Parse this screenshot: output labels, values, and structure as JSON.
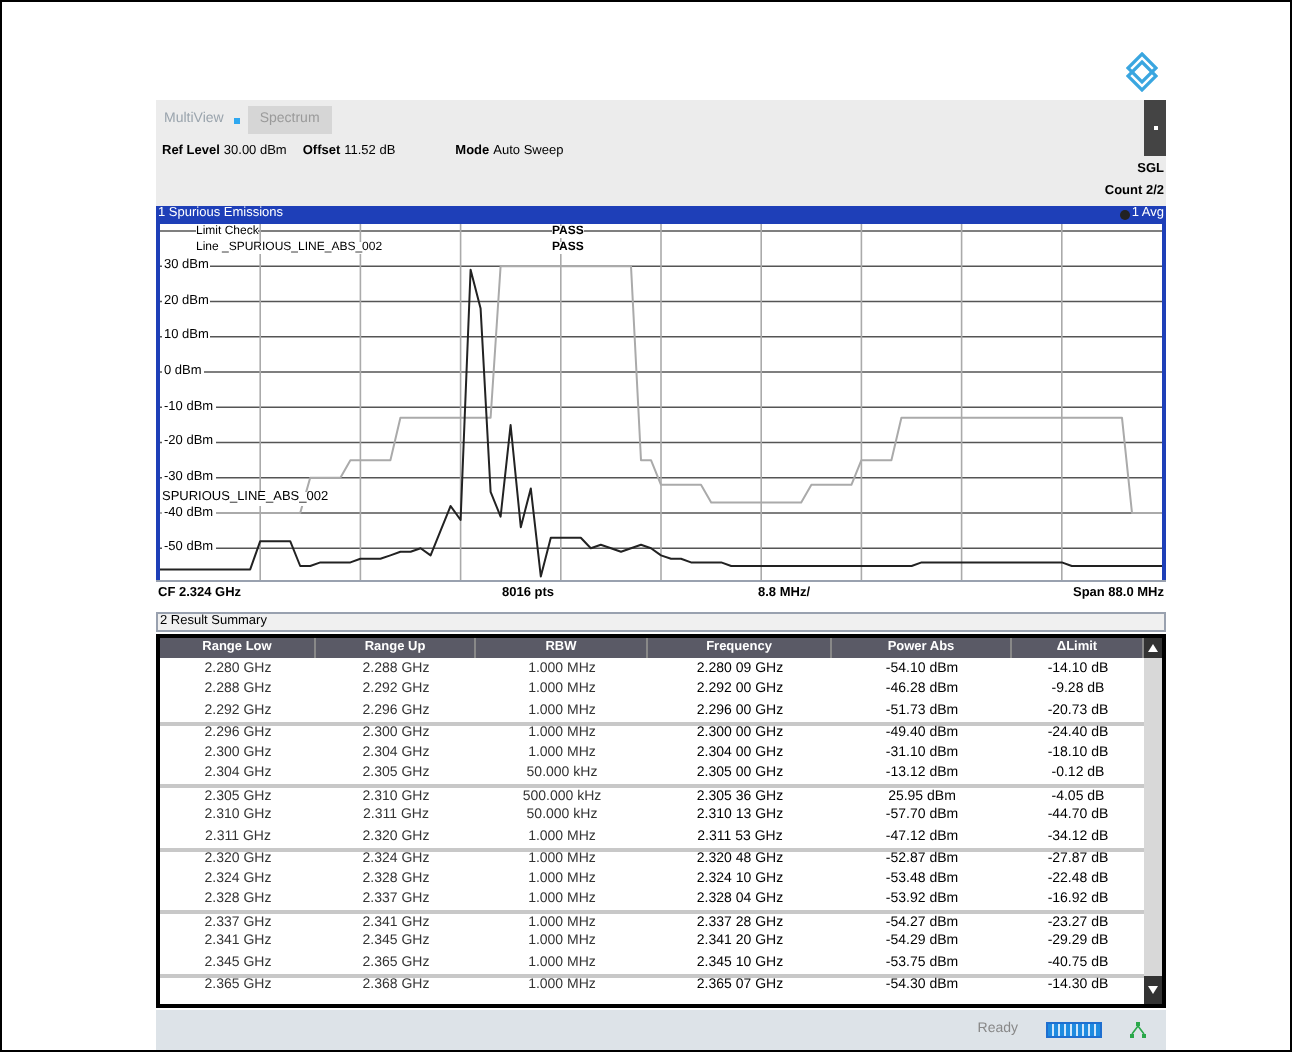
{
  "tabs": [
    {
      "label": "MultiView",
      "selected": false
    },
    {
      "label": "Spectrum",
      "selected": true
    }
  ],
  "parameters": [
    {
      "label": "Ref Level",
      "value": "30.00 dBm"
    },
    {
      "label": "Offset",
      "value": "11.52 dB"
    },
    {
      "label": "Mode",
      "value": "Auto Sweep"
    }
  ],
  "sweep_info": [
    "SGL",
    "Count 2/2"
  ],
  "diagram": {
    "title": "1 Spurious Emissions",
    "trace_info": "1 Avg",
    "limit_check": {
      "title": "Limit Check",
      "line_label": "Line _SPURIOUS_LINE_ABS_002",
      "results": [
        "PASS",
        "PASS"
      ]
    },
    "limit_line_label": "SPURIOUS_LINE_ABS_002",
    "chart_data": {
      "type": "line",
      "ylim": [
        -59,
        42
      ],
      "grid": true,
      "yticks": [
        {
          "value": 30,
          "label": "30 dBm"
        },
        {
          "value": 20,
          "label": "20 dBm"
        },
        {
          "value": 10,
          "label": "10 dBm"
        },
        {
          "value": 0,
          "label": "0 dBm"
        },
        {
          "value": -10,
          "label": "-10 dBm"
        },
        {
          "value": -20,
          "label": "-20 dBm"
        },
        {
          "value": -30,
          "label": "-30 dBm"
        },
        {
          "value": -40,
          "label": "-40 dBm"
        },
        {
          "value": -50,
          "label": "-50 dBm"
        }
      ],
      "categories": [
        null,
        null,
        null,
        null,
        null,
        null,
        null,
        null,
        null,
        null,
        null,
        null,
        null,
        null,
        null,
        null,
        null,
        null,
        null,
        null,
        null,
        null,
        null,
        null,
        null,
        null,
        null,
        null,
        null,
        null,
        null,
        null,
        null,
        null,
        null,
        null,
        null,
        null,
        null,
        null,
        null,
        null,
        null,
        null,
        null,
        null,
        null,
        null,
        null,
        null,
        null,
        null,
        null,
        null,
        null,
        null,
        null,
        null,
        null,
        null,
        null,
        null,
        null,
        null,
        null,
        null,
        null,
        null,
        null,
        null,
        null,
        null,
        null,
        null,
        null,
        null,
        null,
        null,
        null,
        null,
        null,
        null,
        null,
        null,
        null,
        null,
        null,
        null,
        null,
        null,
        null,
        null,
        null,
        null,
        null,
        null,
        null,
        null,
        null,
        null,
        null
      ],
      "series": [
        {
          "color": "#222222",
          "values": [
            -56,
            -56,
            -56,
            -56,
            -56,
            -56,
            -56,
            -56,
            -56,
            -56,
            -48,
            -48,
            -48,
            -48,
            -55,
            -55,
            -54,
            -54,
            -54,
            -54,
            -53,
            -53,
            -53,
            -52,
            -51,
            -51,
            -50,
            -52,
            -45,
            -38,
            -42,
            29,
            18,
            -34,
            -41,
            -15,
            -44,
            -33,
            -58,
            -47,
            -47,
            -47,
            -47,
            -50,
            -49,
            -50,
            -51,
            -50,
            -49,
            -50,
            -52,
            -53,
            -53,
            -54,
            -54,
            -54,
            -54,
            -55,
            -55,
            -55,
            -55,
            -55,
            -55,
            -55,
            -55,
            -55,
            -55,
            -55,
            -55,
            -55,
            -55,
            -55,
            -55,
            -55,
            -55,
            -55,
            -54,
            -54,
            -54,
            -54,
            -54,
            -54,
            -54,
            -54,
            -54,
            -54,
            -54,
            -54,
            -54,
            -54,
            -54,
            -55,
            -55,
            -55,
            -55,
            -55,
            -55,
            -55,
            -55,
            -55,
            -55
          ]
        },
        {
          "color": "#aaaaaa",
          "values": [
            -40,
            -40,
            -40,
            -40,
            -40,
            -40,
            -40,
            -40,
            -40,
            -40,
            -40,
            -40,
            -40,
            -40,
            -40,
            -30,
            -30,
            -30,
            -30,
            -25,
            -25,
            -25,
            -25,
            -25,
            -13,
            -13,
            -13,
            -13,
            -13,
            -13,
            -13,
            -13,
            -13,
            -13,
            30,
            30,
            30,
            30,
            30,
            30,
            30,
            30,
            30,
            30,
            30,
            30,
            30,
            30,
            -25,
            -25,
            -32,
            -32,
            -32,
            -32,
            -32,
            -37,
            -37,
            -37,
            -37,
            -37,
            -37,
            -37,
            -37,
            -37,
            -37,
            -32,
            -32,
            -32,
            -32,
            -32,
            -25,
            -25,
            -25,
            -25,
            -13,
            -13,
            -13,
            -13,
            -13,
            -13,
            -13,
            -13,
            -13,
            -13,
            -13,
            -13,
            -13,
            -13,
            -13,
            -13,
            -13,
            -13,
            -13,
            -13,
            -13,
            -13,
            -13,
            -40,
            -40,
            -40,
            -40
          ]
        }
      ]
    },
    "footer": [
      "CF 2.324 GHz",
      "8016 pts",
      "8.8 MHz/",
      "Span 88.0 MHz"
    ]
  },
  "result_summary": {
    "title": "2 Result Summary",
    "columns": [
      "Range Low",
      "Range Up",
      "RBW",
      "Frequency",
      "Power Abs",
      "ΔLimit"
    ],
    "rows": [
      [
        "2.280 GHz",
        "2.288 GHz",
        "1.000 MHz",
        "2.280 09 GHz",
        "-54.10 dBm",
        "-14.10 dB"
      ],
      [
        "2.288 GHz",
        "2.292 GHz",
        "1.000 MHz",
        "2.292 00 GHz",
        "-46.28 dBm",
        "-9.28 dB"
      ],
      [
        "2.292 GHz",
        "2.296 GHz",
        "1.000 MHz",
        "2.296 00 GHz",
        "-51.73 dBm",
        "-20.73 dB"
      ],
      [
        "2.296 GHz",
        "2.300 GHz",
        "1.000 MHz",
        "2.300 00 GHz",
        "-49.40 dBm",
        "-24.40 dB"
      ],
      [
        "2.300 GHz",
        "2.304 GHz",
        "1.000 MHz",
        "2.304 00 GHz",
        "-31.10 dBm",
        "-18.10 dB"
      ],
      [
        "2.304 GHz",
        "2.305 GHz",
        "50.000 kHz",
        "2.305 00 GHz",
        "-13.12 dBm",
        "-0.12 dB"
      ],
      [
        "2.305 GHz",
        "2.310 GHz",
        "500.000 kHz",
        "2.305 36 GHz",
        "25.95 dBm",
        "-4.05 dB"
      ],
      [
        "2.310 GHz",
        "2.311 GHz",
        "50.000 kHz",
        "2.310 13 GHz",
        "-57.70 dBm",
        "-44.70 dB"
      ],
      [
        "2.311 GHz",
        "2.320 GHz",
        "1.000 MHz",
        "2.311 53 GHz",
        "-47.12 dBm",
        "-34.12 dB"
      ],
      [
        "2.320 GHz",
        "2.324 GHz",
        "1.000 MHz",
        "2.320 48 GHz",
        "-52.87 dBm",
        "-27.87 dB"
      ],
      [
        "2.324 GHz",
        "2.328 GHz",
        "1.000 MHz",
        "2.324 10 GHz",
        "-53.48 dBm",
        "-22.48 dB"
      ],
      [
        "2.328 GHz",
        "2.337 GHz",
        "1.000 MHz",
        "2.328 04 GHz",
        "-53.92 dBm",
        "-16.92 dB"
      ],
      [
        "2.337 GHz",
        "2.341 GHz",
        "1.000 MHz",
        "2.337 28 GHz",
        "-54.27 dBm",
        "-23.27 dB"
      ],
      [
        "2.341 GHz",
        "2.345 GHz",
        "1.000 MHz",
        "2.341 20 GHz",
        "-54.29 dBm",
        "-29.29 dB"
      ],
      [
        "2.345 GHz",
        "2.365 GHz",
        "1.000 MHz",
        "2.345 10 GHz",
        "-53.75 dBm",
        "-40.75 dB"
      ],
      [
        "2.365 GHz",
        "2.368 GHz",
        "1.000 MHz",
        "2.365 07 GHz",
        "-54.30 dBm",
        "-14.30 dB"
      ]
    ]
  },
  "status_bar": {
    "status": "Ready",
    "sweep_progress": {
      "level": 1
    }
  }
}
